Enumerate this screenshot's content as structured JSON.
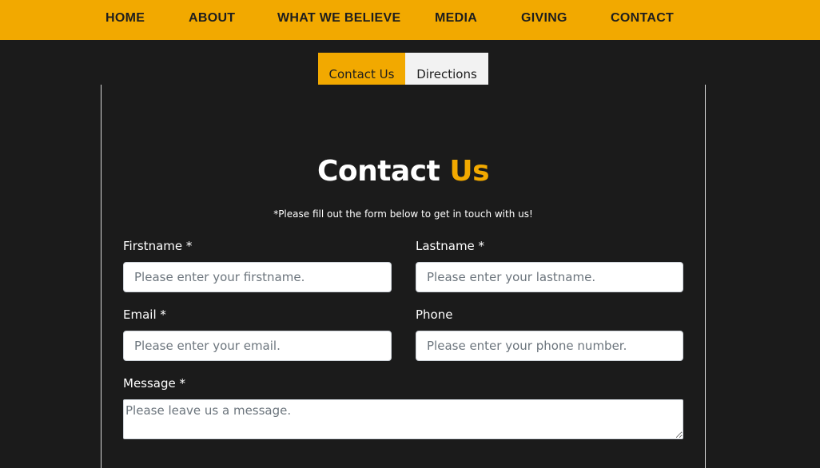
{
  "nav": {
    "items": [
      {
        "label": "HOME"
      },
      {
        "label": "ABOUT"
      },
      {
        "label": "WHAT WE BELIEVE"
      },
      {
        "label": "MEDIA"
      },
      {
        "label": "GIVING"
      },
      {
        "label": "CONTACT"
      }
    ]
  },
  "tabs": {
    "active": "Contact Us",
    "inactive": "Directions"
  },
  "heading": {
    "title_main": "Contact",
    "title_accent": "Us",
    "subtitle": "*Please fill out the form below to get in touch with us!"
  },
  "form": {
    "firstname": {
      "label": "Firstname *",
      "placeholder": "Please enter your firstname."
    },
    "lastname": {
      "label": "Lastname *",
      "placeholder": "Please enter your lastname."
    },
    "email": {
      "label": "Email *",
      "placeholder": "Please enter your email."
    },
    "phone": {
      "label": "Phone",
      "placeholder": "Please enter your phone number."
    },
    "message": {
      "label": "Message *",
      "placeholder": "Please leave us a message."
    }
  },
  "colors": {
    "accent": "#f2a900",
    "background": "#1b1b1b",
    "text_dark": "#1e1e1e",
    "text_light": "#ffffff"
  }
}
